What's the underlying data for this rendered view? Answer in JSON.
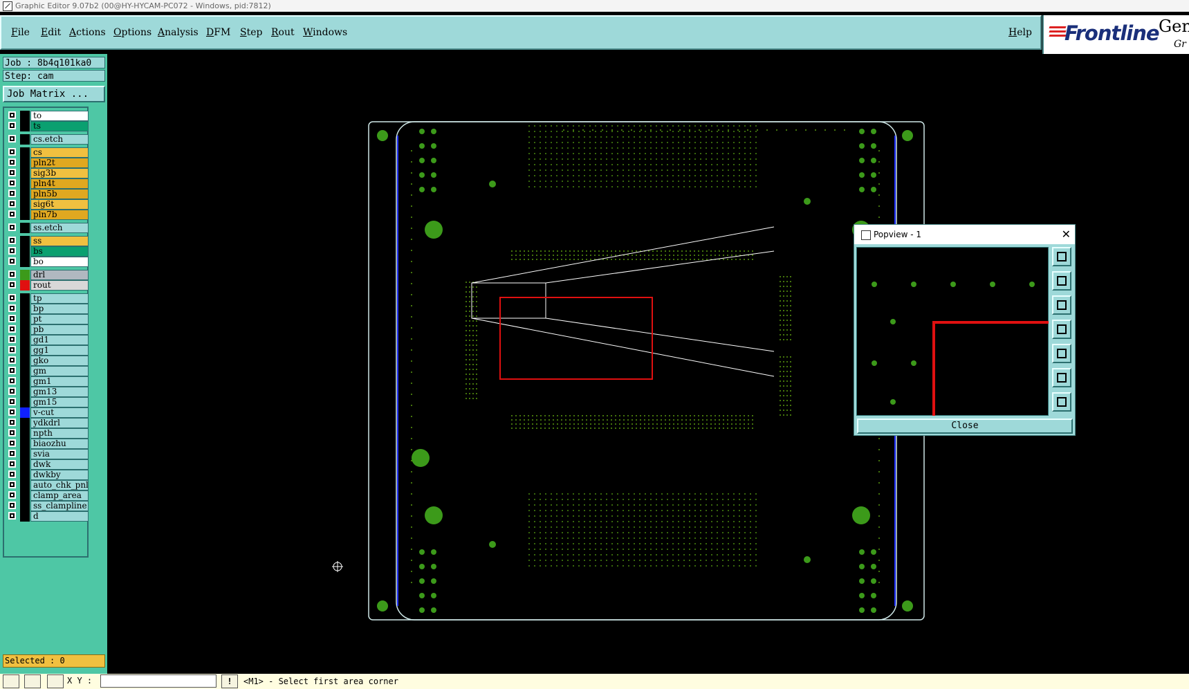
{
  "window": {
    "title": "Graphic Editor 9.07b2 (00@HY-HYCAM-PC072 - Windows, pid:7812)"
  },
  "menu": {
    "items": [
      "File",
      "Edit",
      "Actions",
      "Options",
      "Analysis",
      "DFM",
      "Step",
      "Rout",
      "Windows"
    ],
    "help": "Help"
  },
  "logo": {
    "brand": "Frontline",
    "gen": "Gen",
    "gr": "Gr"
  },
  "job": {
    "job_label": "Job : 8b4q101ka0",
    "step_label": "Step: cam",
    "matrix_button": "Job Matrix ..."
  },
  "layers": [
    {
      "name": "to",
      "color": "#ffffff"
    },
    {
      "name": "ts",
      "color": "#0aa070"
    },
    {
      "name": "cs.etch",
      "color": "#9ed9d9"
    },
    {
      "name": "cs",
      "color": "#f0c040"
    },
    {
      "name": "pln2t",
      "color": "#e0a820"
    },
    {
      "name": "sig3b",
      "color": "#f0c040"
    },
    {
      "name": "pln4t",
      "color": "#e0a820"
    },
    {
      "name": "pln5b",
      "color": "#e0a820"
    },
    {
      "name": "sig6t",
      "color": "#f0c040"
    },
    {
      "name": "pln7b",
      "color": "#e0a820"
    },
    {
      "name": "ss.etch",
      "color": "#9ed9d9"
    },
    {
      "name": "ss",
      "color": "#f0c040"
    },
    {
      "name": "bs",
      "color": "#0aa070"
    },
    {
      "name": "bo",
      "color": "#ffffff"
    },
    {
      "name": "drl",
      "color": "#b0b8c0"
    },
    {
      "name": "rout",
      "color": "#d8d8d8"
    },
    {
      "name": "tp",
      "color": "#9ed9d9"
    },
    {
      "name": "bp",
      "color": "#9ed9d9"
    },
    {
      "name": "pt",
      "color": "#9ed9d9"
    },
    {
      "name": "pb",
      "color": "#9ed9d9"
    },
    {
      "name": "gd1",
      "color": "#9ed9d9"
    },
    {
      "name": "gg1",
      "color": "#9ed9d9"
    },
    {
      "name": "gko",
      "color": "#9ed9d9"
    },
    {
      "name": "gm",
      "color": "#9ed9d9"
    },
    {
      "name": "gm1",
      "color": "#9ed9d9"
    },
    {
      "name": "gm13",
      "color": "#9ed9d9"
    },
    {
      "name": "gm15",
      "color": "#9ed9d9"
    },
    {
      "name": "v-cut",
      "color": "#9ed9d9"
    },
    {
      "name": "ydkdrl",
      "color": "#9ed9d9"
    },
    {
      "name": "npth",
      "color": "#9ed9d9"
    },
    {
      "name": "biaozhu",
      "color": "#9ed9d9"
    },
    {
      "name": "svia",
      "color": "#9ed9d9"
    },
    {
      "name": "dwk",
      "color": "#9ed9d9"
    },
    {
      "name": "dwkby",
      "color": "#9ed9d9"
    },
    {
      "name": "auto_chk_pnl",
      "color": "#9ed9d9"
    },
    {
      "name": "clamp_area",
      "color": "#9ed9d9"
    },
    {
      "name": "ss_clampline",
      "color": "#9ed9d9"
    },
    {
      "name": "d",
      "color": "#9ed9d9"
    }
  ],
  "selected_label": "Selected : 0",
  "status": {
    "xy_label": "X Y :",
    "xy_value": "",
    "message": "<M1> - Select first area corner"
  },
  "popview": {
    "title": "Popview - 1",
    "close_label": "Close"
  },
  "colors": {
    "accent": "#9ed9d9",
    "panel": "#4ec7a5",
    "pad": "#3c9a1a",
    "board_outline": "#cfe8e8",
    "zoom_rect": "#e01010"
  },
  "icons": [
    "app-icon",
    "close-icon",
    "zoom-in-icon",
    "pan-up-icon",
    "pan-down-icon",
    "pan-left-icon",
    "pan-right-icon",
    "zoom-fit-icon",
    "zoom-out-icon"
  ]
}
